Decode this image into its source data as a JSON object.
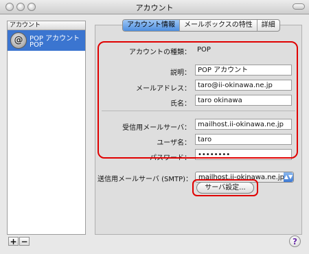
{
  "window": {
    "title": "アカウント"
  },
  "sidebar": {
    "header": "アカウント",
    "accounts": [
      {
        "name": "POP アカウント",
        "type": "POP",
        "icon": "at-sign-icon"
      }
    ],
    "add_label": "+",
    "remove_label": "−"
  },
  "tabs": [
    {
      "label": "アカウント情報",
      "active": true
    },
    {
      "label": "メールボックスの特性",
      "active": false
    },
    {
      "label": "詳細",
      "active": false
    }
  ],
  "form": {
    "account_type_label": "アカウントの種類：",
    "account_type_value": "POP",
    "description_label": "説明：",
    "description_value": "POP アカウント",
    "email_label": "メールアドレス：",
    "email_value": "taro@ii-okinawa.ne.jp",
    "fullname_label": "氏名：",
    "fullname_value": "taro okinawa",
    "incoming_label": "受信用メールサーバ：",
    "incoming_value": "mailhost.ii-okinawa.ne.jp",
    "username_label": "ユーザ名：",
    "username_value": "taro",
    "password_label": "パスワード：",
    "password_value": "••••••••",
    "smtp_label": "送信用メールサーバ (SMTP)：",
    "smtp_value": "mailhost.ii-okinawa.ne.jp",
    "server_settings_label": "サーバ設定..."
  },
  "help_label": "?",
  "colors": {
    "highlight": "#e00000",
    "selection": "#3b75d0"
  }
}
